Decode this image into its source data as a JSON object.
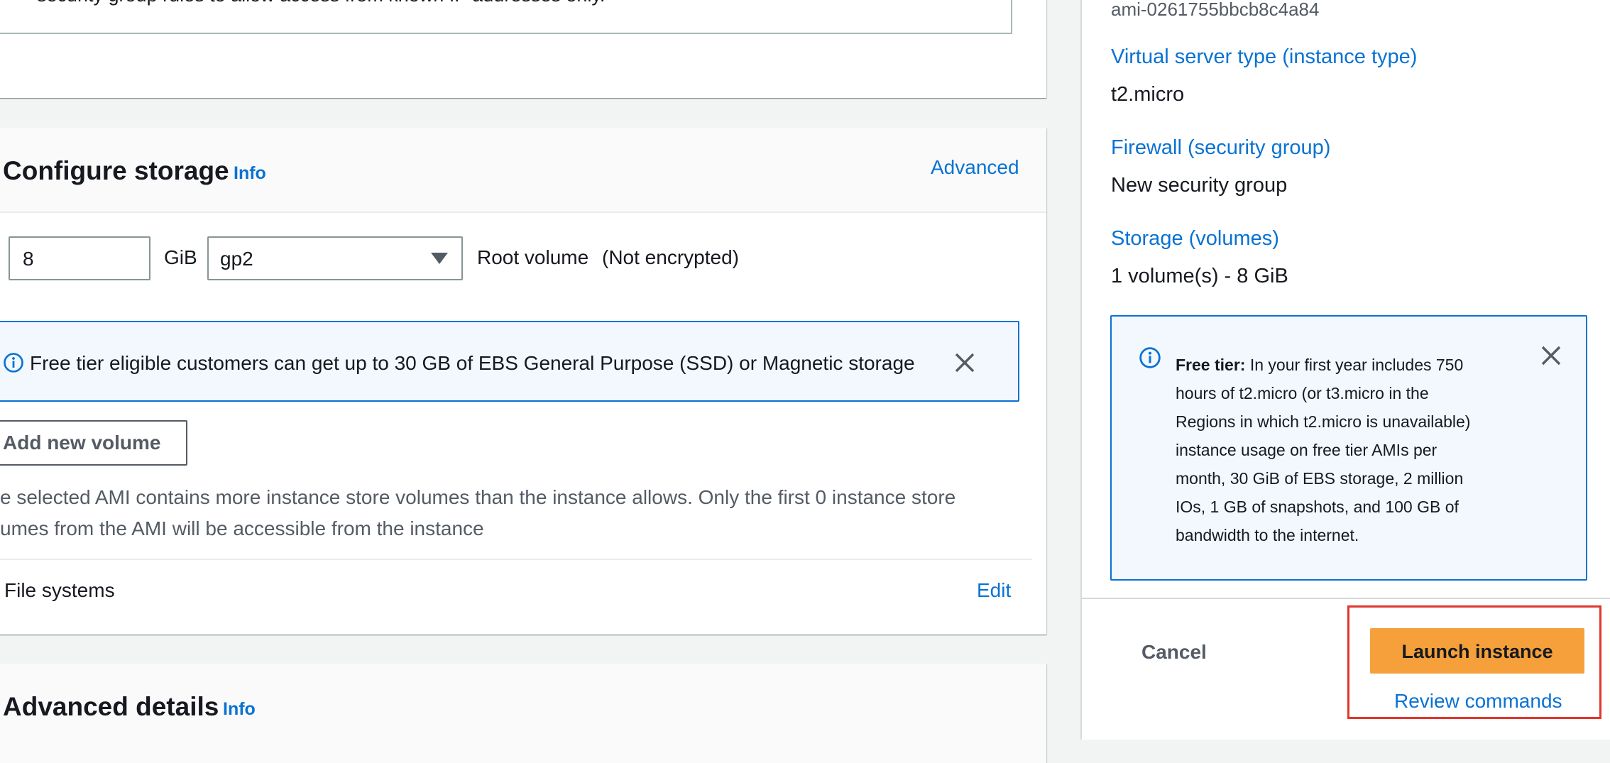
{
  "main": {
    "top_alert_text": "security group rules to allow access from known IP addresses only.",
    "storage": {
      "title": "Configure storage",
      "info": "Info",
      "advanced": "Advanced",
      "size_value": "8",
      "unit": "GiB",
      "volume_type": "gp2",
      "root_label": "Root volume",
      "encryption": "(Not encrypted)",
      "free_tier_alert": "Free tier eligible customers can get up to 30 GB of EBS General Purpose (SSD) or Magnetic storage",
      "add_volume": "Add new volume",
      "note_line1": "e selected AMI contains more instance store volumes than the instance allows. Only the first 0 instance store",
      "note_line2": "umes from the AMI will be accessible from the instance",
      "file_systems": "File systems",
      "edit": "Edit"
    },
    "advanced_details": {
      "title": "Advanced details",
      "info": "Info"
    }
  },
  "summary": {
    "ami_id": "ami-0261755bbcb8c4a84",
    "instance_type_label": "Virtual server type (instance type)",
    "instance_type_value": "t2.micro",
    "firewall_label": "Firewall (security group)",
    "firewall_value": "New security group",
    "storage_label": "Storage (volumes)",
    "storage_value": "1 volume(s) - 8 GiB",
    "free_tier_bold": "Free tier:",
    "free_tier_lines": [
      "In your first year includes 750",
      "hours of t2.micro (or t3.micro in the",
      "Regions in which t2.micro is unavailable)",
      "instance usage on free tier AMIs per",
      "month, 30 GiB of EBS storage, 2 million",
      "IOs, 1 GB of snapshots, and 100 GB of",
      "bandwidth to the internet."
    ],
    "cancel": "Cancel",
    "launch": "Launch instance",
    "review": "Review commands"
  },
  "colors": {
    "accent": "#0972d3",
    "primary_button": "#f5a03a",
    "highlight_box": "#e0362b",
    "alert_bg": "#f2f8fd"
  }
}
